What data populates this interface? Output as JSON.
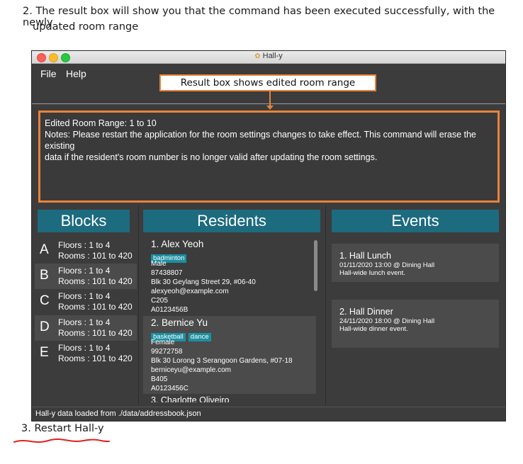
{
  "doc": {
    "step2_line1": "2. The result box will show you that the command has been executed successfully, with the newly",
    "step2_line2": "updated room range",
    "step3": "3. Restart Hall-y"
  },
  "window": {
    "title": "Hall-y",
    "menu": [
      "File",
      "Help"
    ],
    "status": "Hall-y data loaded from ./data/addressbook.json"
  },
  "callout": "Result box shows edited room range",
  "result": {
    "line1": "Edited Room Range: 1 to 10",
    "line2": "Notes: Please restart the application for the room settings changes to take effect. This command will erase the existing",
    "line3": "data if the resident's room number is no longer valid after updating the room settings."
  },
  "headers": {
    "blocks": "Blocks",
    "residents": "Residents",
    "events": "Events"
  },
  "blocks": [
    {
      "letter": "A",
      "floors": "Floors : 1 to 4",
      "rooms": "Rooms : 101 to 420"
    },
    {
      "letter": "B",
      "floors": "Floors : 1 to 4",
      "rooms": "Rooms : 101 to 420"
    },
    {
      "letter": "C",
      "floors": "Floors : 1 to 4",
      "rooms": "Rooms : 101 to 420"
    },
    {
      "letter": "D",
      "floors": "Floors : 1 to 4",
      "rooms": "Rooms : 101 to 420"
    },
    {
      "letter": "E",
      "floors": "Floors : 1 to 4",
      "rooms": "Rooms : 101 to 420"
    }
  ],
  "residents": [
    {
      "name": "1.  Alex Yeoh",
      "tags": [
        "badminton"
      ],
      "gender": "Male",
      "phone": "87438807",
      "address": "Blk 30 Geylang Street 29, #06-40",
      "email": "alexyeoh@example.com",
      "room": "C205",
      "matric": "A0123456B"
    },
    {
      "name": "2.  Bernice Yu",
      "tags": [
        "basketball",
        "dance"
      ],
      "gender": "Female",
      "phone": "99272758",
      "address": "Blk 30 Lorong 3 Serangoon Gardens, #07-18",
      "email": "berniceyu@example.com",
      "room": "B405",
      "matric": "A0123456C"
    },
    {
      "name": "3.  Charlotte Oliveiro"
    }
  ],
  "events": [
    {
      "title": "1.  Hall Lunch",
      "when": "01/11/2020 13:00 @ Dining Hall",
      "desc": "Hall-wide lunch event."
    },
    {
      "title": "2.  Hall Dinner",
      "when": "24/11/2020 18:00 @ Dining Hall",
      "desc": "Hall-wide dinner event."
    }
  ],
  "colors": {
    "accent_orange": "#e8833a",
    "header_teal": "#1d6b7f",
    "tag_teal": "#1b8fa0",
    "underline_red": "#e02020"
  }
}
